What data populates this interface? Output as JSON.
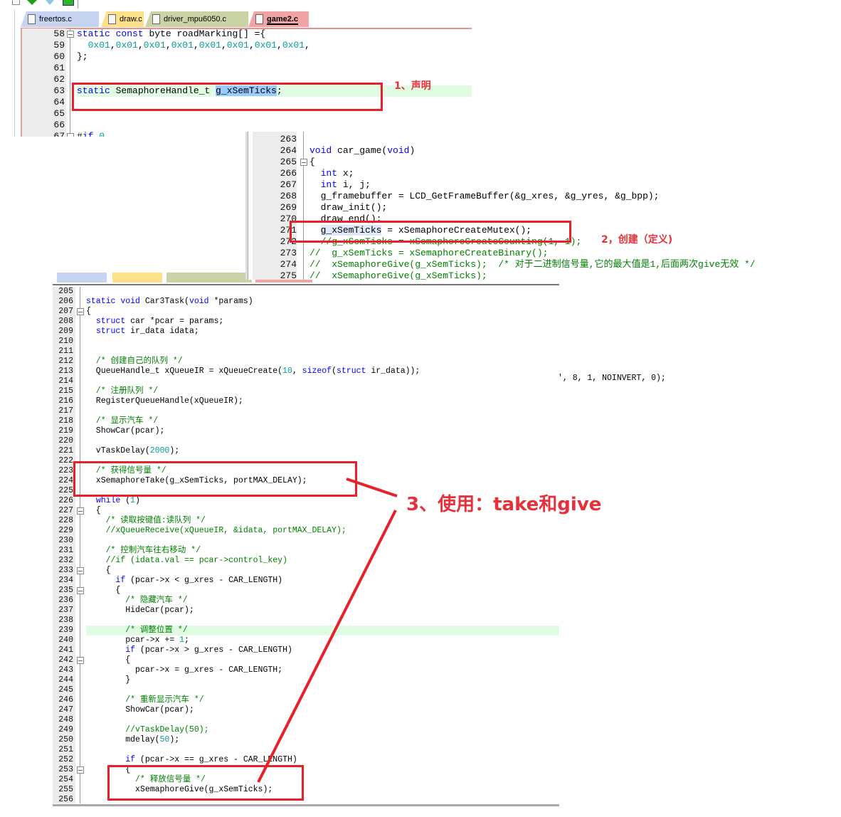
{
  "toolbar": {
    "icons": [
      "page-icon",
      "green-download-icon",
      "filter-icon",
      "green-check-icon"
    ]
  },
  "tabs": [
    {
      "label": "freertos.c",
      "color": "#c6d4f0"
    },
    {
      "label": "draw.c",
      "color": "#fde08a"
    },
    {
      "label": "driver_mpu6050.c",
      "color": "#c9d3a6"
    },
    {
      "label": "game2.c",
      "color": "#f0a4a4",
      "active": true
    }
  ],
  "panel1": {
    "lines": [
      {
        "n": "58",
        "code": "static const byte roadMarking[] ={",
        "fold": true
      },
      {
        "n": "59",
        "code": "  0x01,0x01,0x01,0x01,0x01,0x01,0x01,0x01,"
      },
      {
        "n": "60",
        "code": "};"
      },
      {
        "n": "61",
        "code": ""
      },
      {
        "n": "62",
        "code": ""
      },
      {
        "n": "63",
        "code": "static SemaphoreHandle_t g_xSemTicks;",
        "highlight": true,
        "selected": "g_xSemTicks"
      },
      {
        "n": "64",
        "code": ""
      },
      {
        "n": "65",
        "code": ""
      },
      {
        "n": "66",
        "code": ""
      },
      {
        "n": "67",
        "code": "#if 0",
        "fold": true
      }
    ]
  },
  "panel2": {
    "lines": [
      {
        "n": "263",
        "code": ""
      },
      {
        "n": "264",
        "code": "void car_game(void)"
      },
      {
        "n": "265",
        "code": "{",
        "fold": true
      },
      {
        "n": "266",
        "code": "  int x;"
      },
      {
        "n": "267",
        "code": "  int i, j;"
      },
      {
        "n": "268",
        "code": "  g_framebuffer = LCD_GetFrameBuffer(&g_xres, &g_yres, &g_bpp);"
      },
      {
        "n": "269",
        "code": "  draw_init();"
      },
      {
        "n": "270",
        "code": "  draw_end();"
      },
      {
        "n": "271",
        "code": "  g_xSemTicks = xSemaphoreCreateMutex();",
        "selected": "g_xSemTicks"
      },
      {
        "n": "272",
        "code": "  //g_xSemTicks = xSemaphoreCreateCounting(1, 1);"
      },
      {
        "n": "273",
        "code": "//  g_xSemTicks = xSemaphoreCreateBinary();"
      },
      {
        "n": "274",
        "code": "//  xSemaphoreGive(g_xSemTicks);  /* 对于二进制信号量,它的最大值是1,后面两次give无效 */"
      },
      {
        "n": "275",
        "code": "//  xSemaphoreGive(g_xSemTicks);"
      }
    ]
  },
  "panel3": {
    "lines": [
      {
        "n": "205",
        "code": ""
      },
      {
        "n": "206",
        "code": "static void Car3Task(void *params)"
      },
      {
        "n": "207",
        "code": "{",
        "fold": true
      },
      {
        "n": "208",
        "code": "  struct car *pcar = params;"
      },
      {
        "n": "209",
        "code": "  struct ir_data idata;"
      },
      {
        "n": "210",
        "code": ""
      },
      {
        "n": "211",
        "code": ""
      },
      {
        "n": "212",
        "code": "  /* 创建自己的队列 */"
      },
      {
        "n": "213",
        "code": "  QueueHandle_t xQueueIR = xQueueCreate(10, sizeof(struct ir_data));"
      },
      {
        "n": "214",
        "code": ""
      },
      {
        "n": "215",
        "code": "  /* 注册队列 */"
      },
      {
        "n": "216",
        "code": "  RegisterQueueHandle(xQueueIR);"
      },
      {
        "n": "217",
        "code": ""
      },
      {
        "n": "218",
        "code": "  /* 显示汽车 */"
      },
      {
        "n": "219",
        "code": "  ShowCar(pcar);"
      },
      {
        "n": "220",
        "code": ""
      },
      {
        "n": "221",
        "code": "  vTaskDelay(2000);"
      },
      {
        "n": "222",
        "code": ""
      },
      {
        "n": "223",
        "code": "  /* 获得信号量 */"
      },
      {
        "n": "224",
        "code": "  xSemaphoreTake(g_xSemTicks, portMAX_DELAY);"
      },
      {
        "n": "225",
        "code": ""
      },
      {
        "n": "226",
        "code": "  while (1)"
      },
      {
        "n": "227",
        "code": "  {",
        "fold": true
      },
      {
        "n": "228",
        "code": "    /* 读取按键值:读队列 */"
      },
      {
        "n": "229",
        "code": "    //xQueueReceive(xQueueIR, &idata, portMAX_DELAY);"
      },
      {
        "n": "230",
        "code": ""
      },
      {
        "n": "231",
        "code": "    /* 控制汽车往右移动 */"
      },
      {
        "n": "232",
        "code": "    //if (idata.val == pcar->control_key)"
      },
      {
        "n": "233",
        "code": "    {",
        "fold": true
      },
      {
        "n": "234",
        "code": "      if (pcar->x < g_xres - CAR_LENGTH)"
      },
      {
        "n": "235",
        "code": "      {",
        "fold": true
      },
      {
        "n": "236",
        "code": "        /* 隐藏汽车 */"
      },
      {
        "n": "237",
        "code": "        HideCar(pcar);"
      },
      {
        "n": "238",
        "code": ""
      },
      {
        "n": "239",
        "code": "        /* 调整位置 */",
        "highlight": true
      },
      {
        "n": "240",
        "code": "        pcar->x += 1;"
      },
      {
        "n": "241",
        "code": "        if (pcar->x > g_xres - CAR_LENGTH)"
      },
      {
        "n": "242",
        "code": "        {",
        "fold": true
      },
      {
        "n": "243",
        "code": "          pcar->x = g_xres - CAR_LENGTH;"
      },
      {
        "n": "244",
        "code": "        }"
      },
      {
        "n": "245",
        "code": ""
      },
      {
        "n": "246",
        "code": "        /* 重新显示汽车 */"
      },
      {
        "n": "247",
        "code": "        ShowCar(pcar);"
      },
      {
        "n": "248",
        "code": ""
      },
      {
        "n": "249",
        "code": "        //vTaskDelay(50);"
      },
      {
        "n": "250",
        "code": "        mdelay(50);"
      },
      {
        "n": "251",
        "code": ""
      },
      {
        "n": "252",
        "code": "        if (pcar->x == g_xres - CAR_LENGTH)"
      },
      {
        "n": "253",
        "code": "        {",
        "fold": true
      },
      {
        "n": "254",
        "code": "          /* 释放信号量 */"
      },
      {
        "n": "255",
        "code": "          xSemaphoreGive(g_xSemTicks);"
      },
      {
        "n": "256",
        "code": ""
      }
    ],
    "stray_fragment": "', 8, 1, NOINVERT, 0);"
  },
  "annotations": {
    "step1": "1、声明",
    "step2": "2，创建（定义)",
    "step3": "3、使用：take和give",
    "color": "#e8202a"
  },
  "colors": {
    "keyword": "#0000ff",
    "number": "#0a9a9a",
    "comment": "#008000",
    "current_line": "#e0fde4",
    "selection": "#99ccff"
  }
}
